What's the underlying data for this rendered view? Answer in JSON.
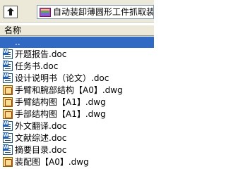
{
  "toolbar": {
    "path_text": "自动装卸薄圆形工件抓取装"
  },
  "header": {
    "name_label": "名称"
  },
  "files": [
    {
      "name": "..",
      "type": "parent",
      "selected": true
    },
    {
      "name": "开题报告.doc",
      "type": "doc"
    },
    {
      "name": "任务书.doc",
      "type": "doc"
    },
    {
      "name": "设计说明书（论文）.doc",
      "type": "doc"
    },
    {
      "name": "手臂和腕部结构【A0】.dwg",
      "type": "dwg"
    },
    {
      "name": "手臂结构图【A1】.dwg",
      "type": "dwg"
    },
    {
      "name": "手部结构图【A1】.dwg",
      "type": "dwg"
    },
    {
      "name": "外文翻译.doc",
      "type": "doc"
    },
    {
      "name": "文献综述.doc",
      "type": "doc"
    },
    {
      "name": "摘要目录.doc",
      "type": "doc"
    },
    {
      "name": "装配图【A0】.dwg",
      "type": "dwg"
    }
  ],
  "colors": {
    "selection": "#316ac5",
    "toolbar_bg": "#ece9d8"
  }
}
